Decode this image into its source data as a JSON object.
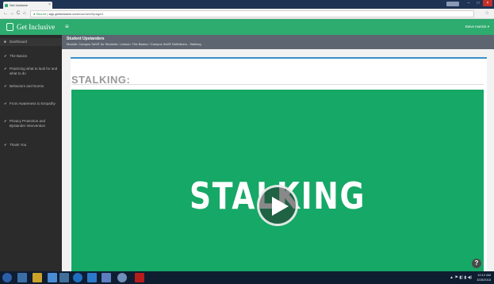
{
  "browser": {
    "tab_title": "Get Inclusive",
    "tab_close": "×",
    "nav_back": "←",
    "nav_forward": "→",
    "nav_reload": "C",
    "nav_home": "⌂",
    "url_secure": "Secure",
    "url_host": "app.getinclusive.com",
    "url_path": "/courses/9/page/1",
    "bookmark": "☆",
    "win_min": "–",
    "win_max": "□",
    "win_close": "×"
  },
  "header": {
    "brand": "Get Inclusive",
    "menu_toggle": "≡",
    "user_name": "Steve Harrick ▾"
  },
  "sidebar": {
    "items": [
      {
        "icon": "■",
        "label": "Dashboard"
      },
      {
        "icon": "✔",
        "label": "The Basics"
      },
      {
        "icon": "✔",
        "label": "Practicing what to look for and what to do"
      },
      {
        "icon": "✔",
        "label": "Behaviors and Norms"
      },
      {
        "icon": "✔",
        "label": "From Awareness to Empathy"
      },
      {
        "icon": "✔",
        "label": "Privacy Protection and Bystander Intervention"
      },
      {
        "icon": "✔",
        "label": "Thank You"
      }
    ]
  },
  "titleband": {
    "course": "Student Upstanders",
    "breadcrumb": "Module: Campus SaVE for Students  /  Lesson: The Basics  /  Campus SaVE Definitions - Stalking"
  },
  "content": {
    "section_title": "STALKING:",
    "video_title": "STALKING",
    "help": "?"
  },
  "taskbar": {
    "tray": "▲ ⚑ ◧ ▮ ◀)",
    "time": "10:12 AM",
    "date": "3/28/2018"
  },
  "colors": {
    "brand_green": "#2eab6f",
    "video_green": "#16a866",
    "sidebar_bg": "#2b2b2b",
    "titleband_bg": "#5d6670",
    "accent_blue": "#3a8fc8"
  }
}
